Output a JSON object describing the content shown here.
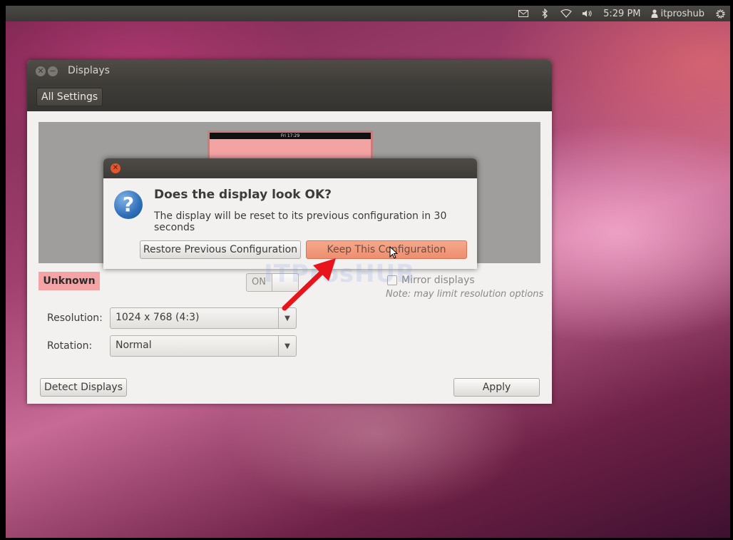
{
  "top_panel": {
    "time": "5:29 PM",
    "user": "itproshub",
    "icons": [
      "mail-icon",
      "bluetooth-icon",
      "wifi-icon",
      "volume-icon",
      "user-icon",
      "gear-icon"
    ]
  },
  "window": {
    "title": "Displays",
    "all_settings": "All Settings",
    "preview_monitor_time": "Fri 17:29",
    "display_name": "Unknown",
    "switch_label": "ON",
    "mirror_label": "Mirror displays",
    "note": "Note: may limit resolution options",
    "resolution_label": "Resolution:",
    "resolution_value": "1024 x 768 (4:3)",
    "rotation_label": "Rotation:",
    "rotation_value": "Normal",
    "detect_button": "Detect Displays",
    "apply_button": "Apply"
  },
  "dialog": {
    "heading": "Does the display look OK?",
    "message": "The display will be reset to its previous configuration in 30 seconds",
    "restore_button": "Restore Previous Configuration",
    "keep_button": "Keep This Configuration"
  },
  "watermark": "ITProsHUB",
  "colors": {
    "accent_keep": "#ee8e70",
    "display_label_bg": "#f4a4a4",
    "arrow": "#e8141c"
  }
}
